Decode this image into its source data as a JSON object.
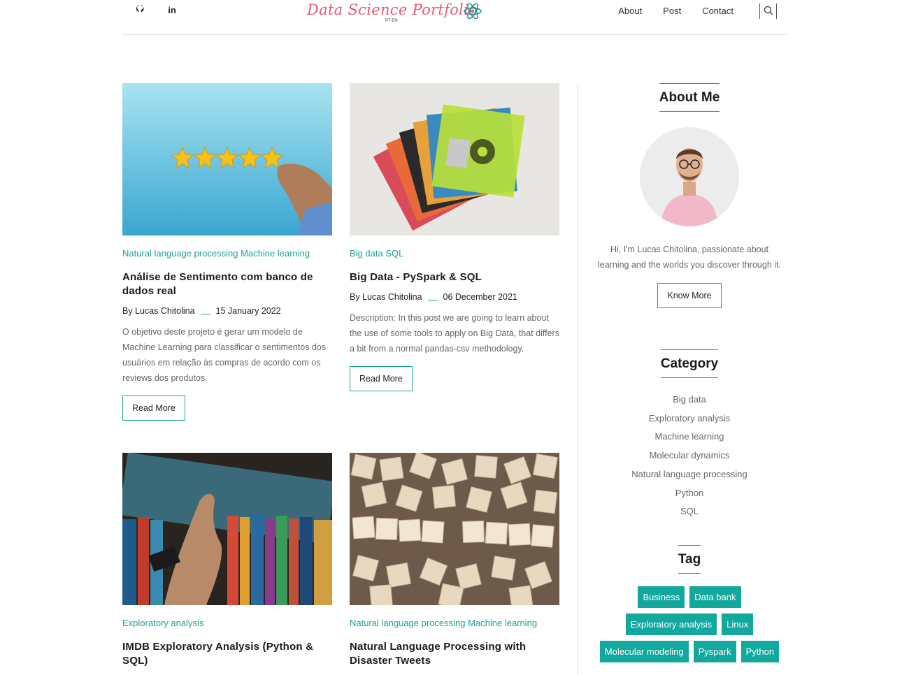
{
  "header": {
    "social": [
      {
        "icon": "github-icon",
        "glyph": "●"
      },
      {
        "icon": "linkedin-icon",
        "glyph": "in"
      }
    ],
    "logo_title": "Data Science Portfolio",
    "logo_sub": "PT-EN",
    "nav": [
      "About",
      "Post",
      "Contact"
    ]
  },
  "posts": [
    {
      "categories": "Natural language processing Machine learning",
      "title": "Análise de Sentimento com banco de dados real",
      "author": "By Lucas Chitolina",
      "date": "15 January 2022",
      "description": "O objetivo deste projeto é gerar um modelo de Machine Learning para classificar o sentimentos dos usuários em relação às compras de acordo com os reviews dos produtos.",
      "read_more": "Read More"
    },
    {
      "categories": "Big data SQL",
      "title": "Big Data - PySpark & SQL",
      "author": "By Lucas Chitolina",
      "date": "06 December 2021",
      "description": "Description: In this post we are going to learn about the use of some tools to apply on Big Data, that differs a bit from a normal pandas-csv methodology.",
      "read_more": "Read More"
    },
    {
      "categories": "Exploratory analysis",
      "title": "IMDB Exploratory Analysis (Python & SQL)"
    },
    {
      "categories": "Natural language processing Machine learning",
      "title": "Natural Language Processing with Disaster Tweets"
    }
  ],
  "sidebar": {
    "about_title": "About Me",
    "about_text": "Hi, I'm Lucas Chitolina, passionate about learning and the worlds you discover through it.",
    "know_more": "Know More",
    "category_title": "Category",
    "categories": [
      "Big data",
      "Exploratory analysis",
      "Machine learning",
      "Molecular dynamics",
      "Natural language processing",
      "Python",
      "SQL"
    ],
    "tag_title": "Tag",
    "tags": [
      "Business",
      "Data bank",
      "Exploratory analysis",
      "Linux",
      "Molecular modeling",
      "Pyspark",
      "Python"
    ]
  },
  "colors": {
    "accent": "#13a89e",
    "logo": "#e05b7a"
  }
}
